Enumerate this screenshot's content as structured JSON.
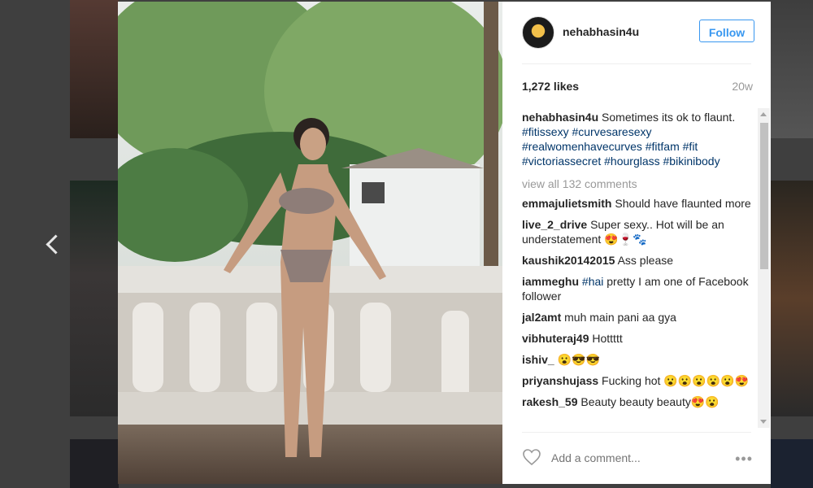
{
  "post": {
    "username": "nehabhasin4u",
    "follow_label": "Follow",
    "likes": "1,272 likes",
    "age": "20w"
  },
  "caption": {
    "user": "nehabhasin4u",
    "text": "Sometimes its ok to flaunt.",
    "hashtags": "#fitissexy #curvesaresexy #realwomenhavecurves #fitfam #fit #victoriassecret #hourglass #bikinibody"
  },
  "view_all": "view all 132 comments",
  "comments": [
    {
      "user": "emmajulietsmith",
      "text": "Should have flaunted more"
    },
    {
      "user": "live_2_drive",
      "text": "Super sexy.. Hot will be an understatement 😍🍷🐾"
    },
    {
      "user": "kaushik20142015",
      "text": "Ass please"
    },
    {
      "user": "iammeghu",
      "tag": "#hai",
      "text": "pretty I am one of Facebook follower"
    },
    {
      "user": "jal2amt",
      "text": "muh main pani aa gya"
    },
    {
      "user": "vibhuteraj49",
      "text": "Hottttt"
    },
    {
      "user": "ishiv_",
      "text": "😮😎😎"
    },
    {
      "user": "priyanshujass",
      "text": "Fucking hot 😮😮😮😮😮😍"
    },
    {
      "user": "rakesh_59",
      "text": "Beauty beauty beauty😍😮"
    }
  ],
  "footer": {
    "comment_placeholder": "Add a comment...",
    "more": "•••"
  },
  "icons": {
    "prev": "chevron-left-icon",
    "like": "heart-icon",
    "options": "more-options-icon"
  }
}
